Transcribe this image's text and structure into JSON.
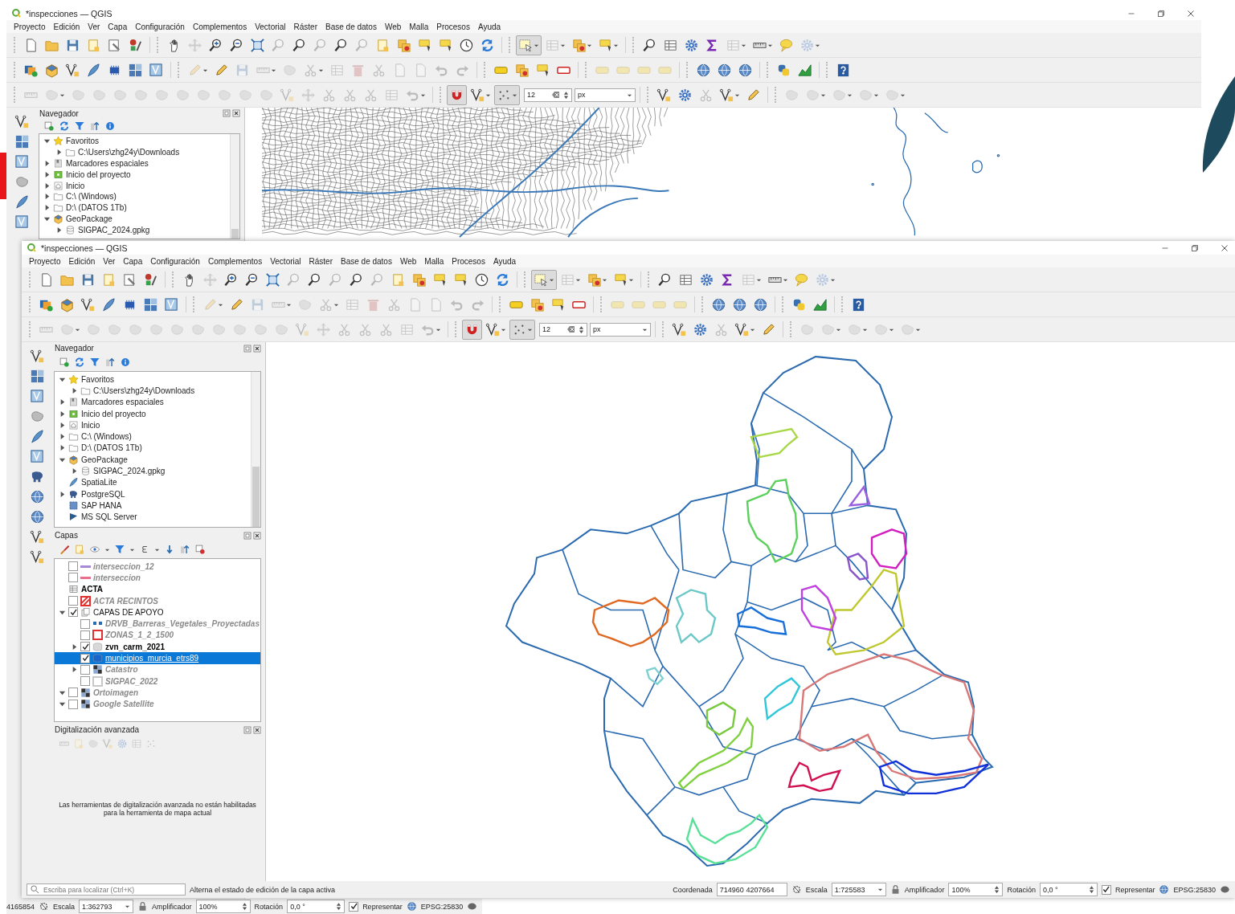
{
  "back_window": {
    "title": "*inspecciones — QGIS",
    "menu": [
      "Proyecto",
      "Edición",
      "Ver",
      "Capa",
      "Configuración",
      "Complementos",
      "Vectorial",
      "Ráster",
      "Base de datos",
      "Web",
      "Malla",
      "Procesos",
      "Ayuda"
    ],
    "snapping": {
      "tolerance": "12",
      "unit": "px"
    },
    "browser": {
      "title": "Navegador",
      "items": [
        {
          "label": "Favoritos",
          "kind": "favorites",
          "expanded": true,
          "children": [
            {
              "label": "C:\\Users\\zhg24y\\Downloads",
              "kind": "folder",
              "expanded": false
            }
          ]
        },
        {
          "label": "Marcadores espaciales",
          "kind": "bookmarks",
          "expanded": false
        },
        {
          "label": "Inicio del proyecto",
          "kind": "project",
          "expanded": false
        },
        {
          "label": "Inicio",
          "kind": "home",
          "expanded": false
        },
        {
          "label": "C:\\ (Windows)",
          "kind": "folder",
          "expanded": false
        },
        {
          "label": "D:\\ (DATOS 1Tb)",
          "kind": "folder",
          "expanded": false
        },
        {
          "label": "GeoPackage",
          "kind": "geopackage",
          "expanded": true,
          "children": [
            {
              "label": "SIGPAC_2024.gpkg",
              "kind": "database",
              "expanded": false
            }
          ]
        }
      ]
    },
    "status_bar": {
      "coordinate": "4165854",
      "scale_label": "Escala",
      "scale": "1:362793",
      "magnifier_label": "Amplificador",
      "magnifier": "100%",
      "rotation_label": "Rotación",
      "rotation": "0,0 °",
      "render_label": "Representar",
      "render": true,
      "crs": "EPSG:25830"
    }
  },
  "front_window": {
    "title": "*inspecciones — QGIS",
    "menu": [
      "Proyecto",
      "Edición",
      "Ver",
      "Capa",
      "Configuración",
      "Complementos",
      "Vectorial",
      "Ráster",
      "Base de datos",
      "Web",
      "Malla",
      "Procesos",
      "Ayuda"
    ],
    "snapping": {
      "tolerance": "12",
      "unit": "px"
    },
    "browser": {
      "title": "Navegador",
      "items": [
        {
          "label": "Favoritos",
          "kind": "favorites",
          "expanded": true,
          "children": [
            {
              "label": "C:\\Users\\zhg24y\\Downloads",
              "kind": "folder",
              "expanded": false
            }
          ]
        },
        {
          "label": "Marcadores espaciales",
          "kind": "bookmarks",
          "expanded": false
        },
        {
          "label": "Inicio del proyecto",
          "kind": "project",
          "expanded": false
        },
        {
          "label": "Inicio",
          "kind": "home",
          "expanded": false
        },
        {
          "label": "C:\\ (Windows)",
          "kind": "folder",
          "expanded": false
        },
        {
          "label": "D:\\ (DATOS 1Tb)",
          "kind": "folder",
          "expanded": false
        },
        {
          "label": "GeoPackage",
          "kind": "geopackage",
          "expanded": true,
          "children": [
            {
              "label": "SIGPAC_2024.gpkg",
              "kind": "database",
              "expanded": false
            }
          ]
        },
        {
          "label": "SpatiaLite",
          "kind": "spatialite"
        },
        {
          "label": "PostgreSQL",
          "kind": "postgresql",
          "expanded": false
        },
        {
          "label": "SAP HANA",
          "kind": "hana"
        },
        {
          "label": "MS SQL Server",
          "kind": "mssql"
        }
      ]
    },
    "layers": {
      "title": "Capas",
      "items": [
        {
          "label": "interseccion_12",
          "kind": "line",
          "color": "#a68ad8",
          "checked": false,
          "selected": false
        },
        {
          "label": "interseccion",
          "kind": "line",
          "color": "#e8708a",
          "checked": false,
          "selected": false
        },
        {
          "label": "ACTA",
          "kind": "table",
          "selected": false
        },
        {
          "label": "ACTA RECINTOS",
          "kind": "hatch",
          "color": "#e03030",
          "checked": false,
          "selected": false
        },
        {
          "label": "CAPAS DE APOYO",
          "kind": "group",
          "checked": true,
          "expanded": true,
          "selected": false,
          "children": [
            {
              "label": "DRVB_Barreras_Vegetales_Proyectadas",
              "kind": "points",
              "color": "#2a6ab0",
              "checked": false,
              "selected": false
            },
            {
              "label": "ZONAS_1_2_1500",
              "kind": "square",
              "color": "#e03030",
              "checked": false,
              "selected": false
            },
            {
              "label": "zvn_carm_2021",
              "kind": "polygon",
              "color": "#d8d8d8",
              "checked": true,
              "expanded": false,
              "selected": false
            },
            {
              "label": "municipios_murcia_etrs89",
              "kind": "polygon",
              "color": "#1a66cc",
              "checked": true,
              "selected": true
            },
            {
              "label": "Catastro",
              "kind": "raster",
              "checked": false,
              "expanded": false,
              "selected": false
            },
            {
              "label": "SIGPAC_2022",
              "kind": "square",
              "color": "#c8c8c8",
              "checked": false,
              "selected": false
            }
          ]
        },
        {
          "label": "Ortoimagen",
          "kind": "raster",
          "checked": false,
          "expanded": true,
          "selected": false
        },
        {
          "label": "Google Satellite",
          "kind": "raster",
          "checked": false,
          "expanded": true,
          "selected": false
        }
      ]
    },
    "digitizing": {
      "title": "Digitalización avanzada",
      "message": "Las herramientas de digitalización avanzada no están habilitadas para la herramienta de mapa actual"
    },
    "status_bar": {
      "search_placeholder": "Escriba para localizar (Ctrl+K)",
      "message": "Alterna el estado de edición de la capa activa",
      "coordinate_label": "Coordenada",
      "coordinate": "714960  4207664",
      "scale_label": "Escala",
      "scale": "1:725583",
      "magnifier_label": "Amplificador",
      "magnifier": "100%",
      "rotation_label": "Rotación",
      "rotation": "0,0 °",
      "render_label": "Representar",
      "render": true,
      "crs": "EPSG:25830"
    }
  }
}
